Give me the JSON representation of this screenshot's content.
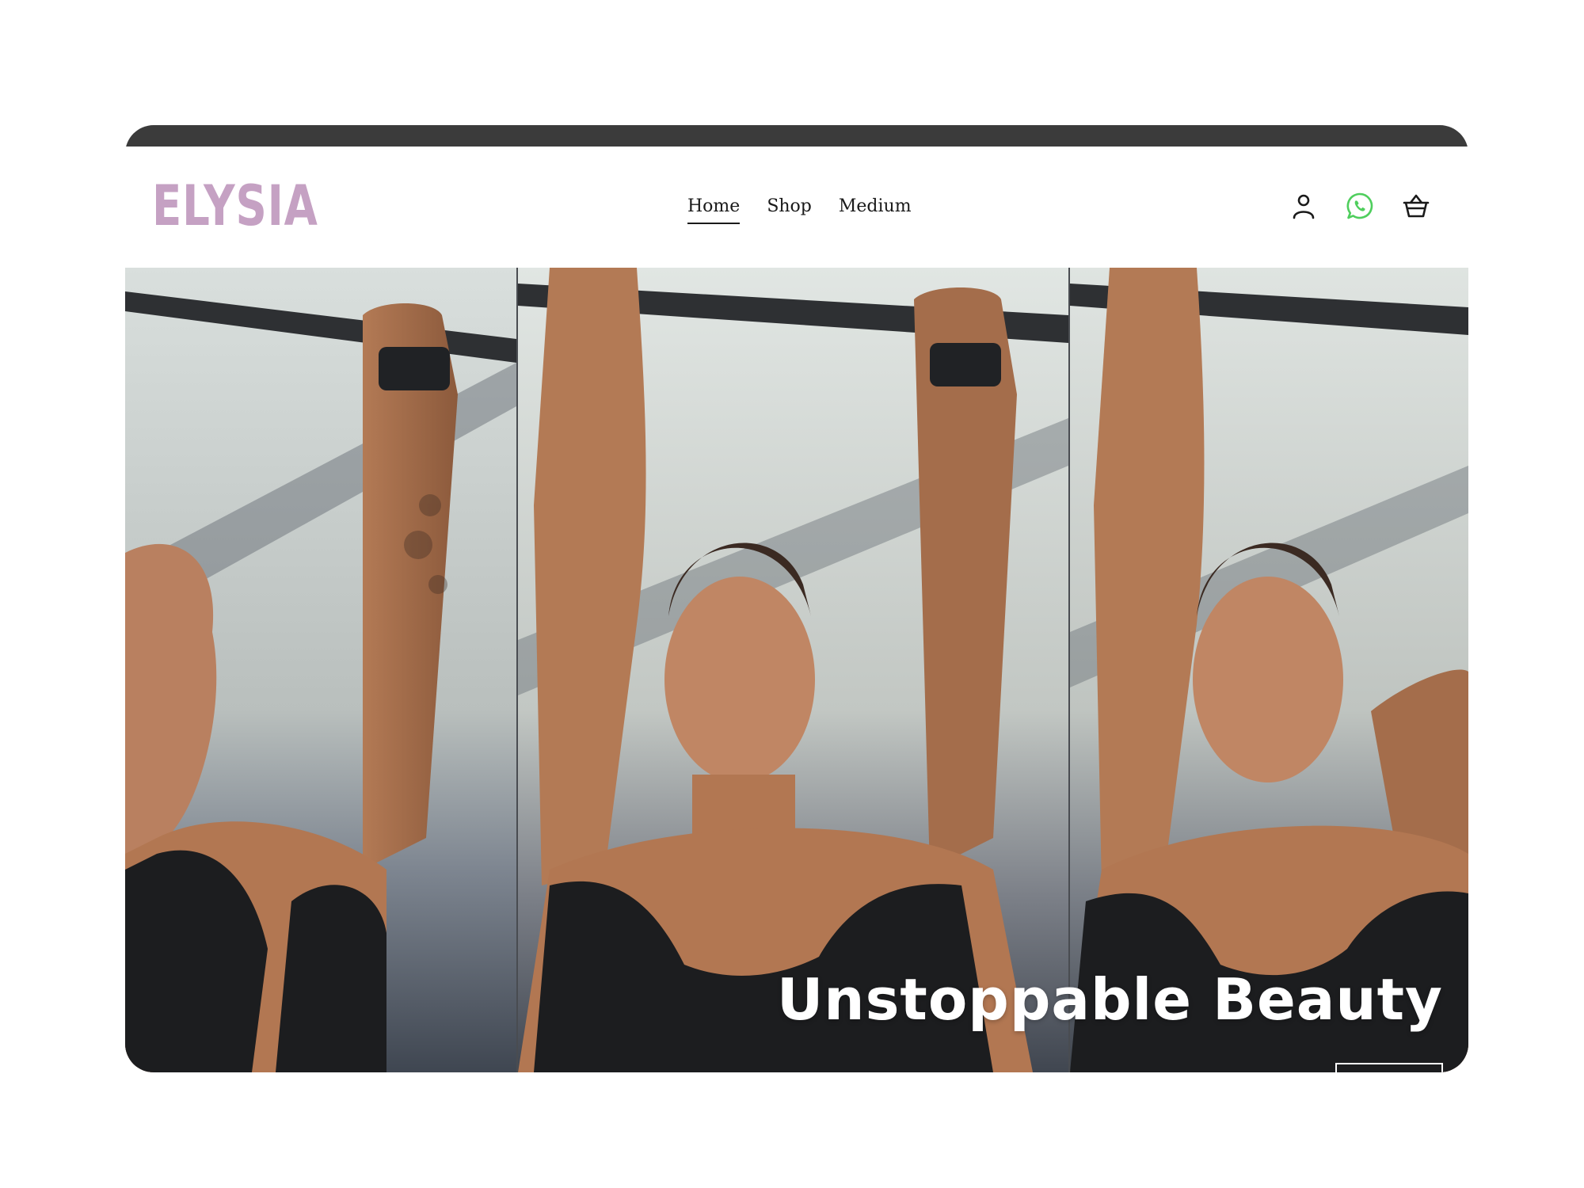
{
  "brand": {
    "name": "ELYSIA",
    "color": "#c5a1c3"
  },
  "nav": {
    "items": [
      {
        "label": "Home",
        "active": true
      },
      {
        "label": "Shop",
        "active": false
      },
      {
        "label": "Medium",
        "active": false
      }
    ]
  },
  "header_icons": [
    "account-icon",
    "whatsapp-icon",
    "basket-icon"
  ],
  "colors": {
    "whatsapp": "#4fce5d",
    "topbar": "#3b3b3b",
    "text": "#1a1a1a"
  },
  "hero": {
    "headline": "Unstoppable Beauty",
    "image_description": "three repeated panels of a woman doing a pull-up on a bar, wearing a black sports top and a watch, tattooed forearm"
  }
}
